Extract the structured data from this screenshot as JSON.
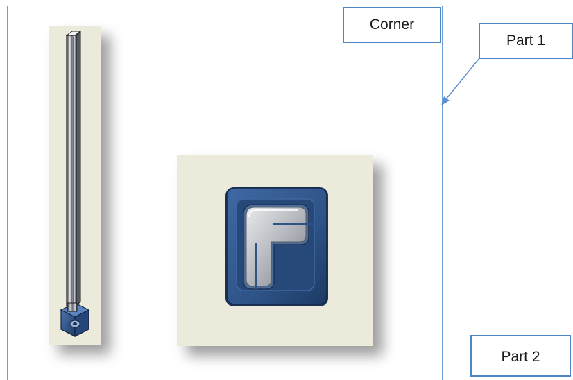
{
  "labels": {
    "corner": "Corner",
    "part1": "Part 1",
    "part2": "Part 2"
  },
  "colors": {
    "frame_border": "#6f9fd4",
    "label_border": "#4f86c6",
    "panel_background": "#ecebdb",
    "part_blue": "#2e5387",
    "rail_gray": "#8a8d92",
    "arrow": "#5b8fcf"
  },
  "icons": [
    "vertical-rail-3d-render",
    "corner-connector-3d-render",
    "callout-arrow"
  ]
}
